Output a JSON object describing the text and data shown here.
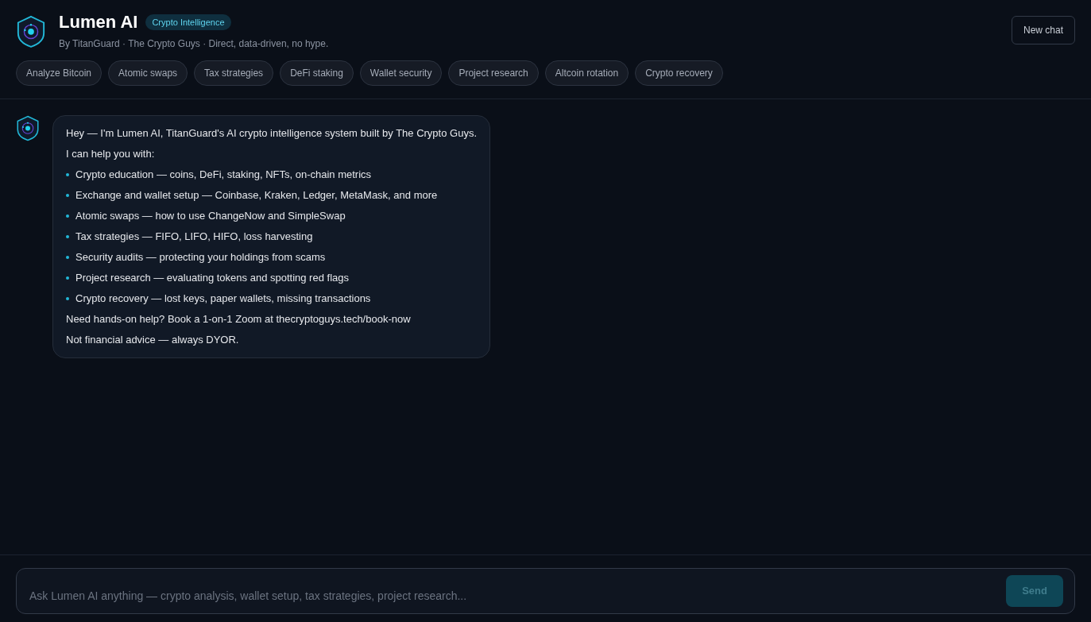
{
  "header": {
    "title": "Lumen AI",
    "badge": "Crypto Intelligence",
    "subtitle": "By TitanGuard · The Crypto Guys · Direct, data-driven, no hype.",
    "new_chat": "New chat"
  },
  "suggestions": [
    "Analyze Bitcoin",
    "Atomic swaps",
    "Tax strategies",
    "DeFi staking",
    "Wallet security",
    "Project research",
    "Altcoin rotation",
    "Crypto recovery"
  ],
  "messages": [
    {
      "blocks": [
        {
          "kind": "text",
          "text": "Hey — I'm Lumen AI, TitanGuard's AI crypto intelligence system built by The Crypto Guys."
        },
        {
          "kind": "text",
          "text": "I can help you with:"
        },
        {
          "kind": "bullet",
          "text": "Crypto education — coins, DeFi, staking, NFTs, on-chain metrics"
        },
        {
          "kind": "bullet",
          "text": "Exchange and wallet setup — Coinbase, Kraken, Ledger, MetaMask, and more"
        },
        {
          "kind": "bullet",
          "text": "Atomic swaps — how to use ChangeNow and SimpleSwap"
        },
        {
          "kind": "bullet",
          "text": "Tax strategies — FIFO, LIFO, HIFO, loss harvesting"
        },
        {
          "kind": "bullet",
          "text": "Security audits — protecting your holdings from scams"
        },
        {
          "kind": "bullet",
          "text": "Project research — evaluating tokens and spotting red flags"
        },
        {
          "kind": "bullet",
          "text": "Crypto recovery — lost keys, paper wallets, missing transactions"
        },
        {
          "kind": "text",
          "text": "Need hands-on help? Book a 1-on-1 Zoom at thecryptoguys.tech/book-now"
        },
        {
          "kind": "text",
          "text": "Not financial advice — always DYOR."
        }
      ]
    }
  ],
  "composer": {
    "placeholder": "Ask Lumen AI anything — crypto analysis, wallet setup, tax strategies, project research...",
    "send": {
      "label": "Send",
      "disabled": true
    }
  }
}
